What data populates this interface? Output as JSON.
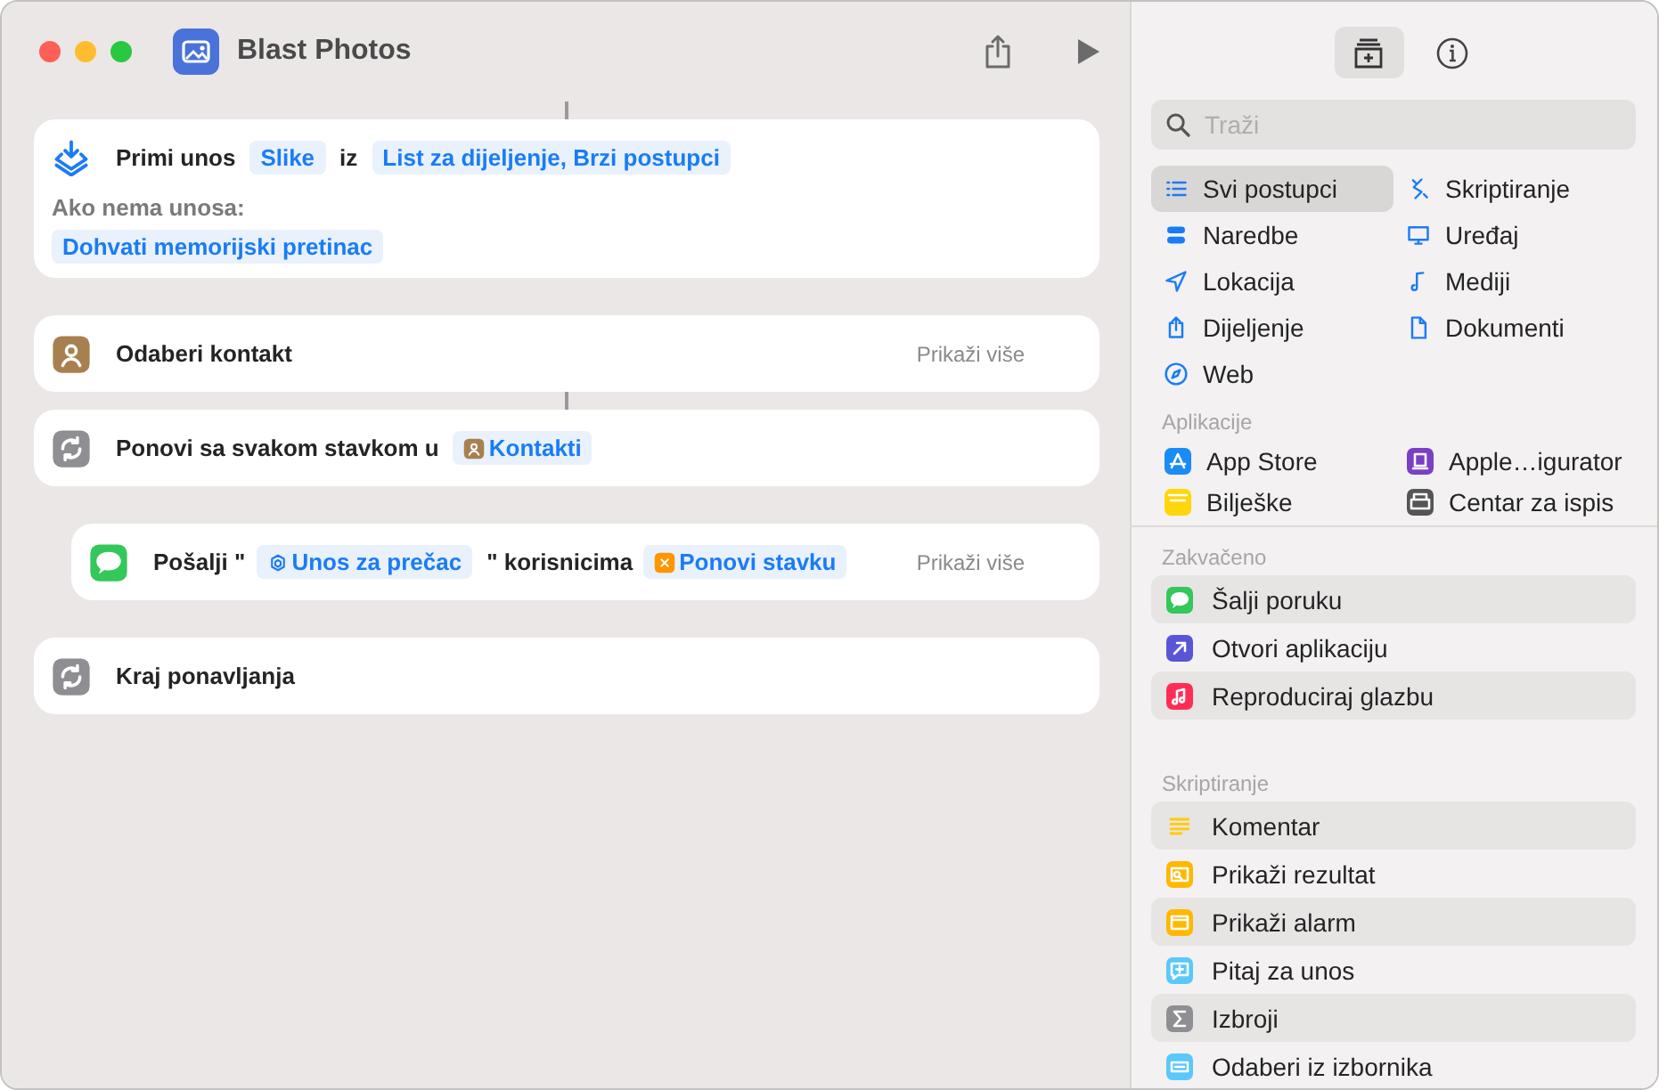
{
  "window": {
    "title": "Blast Photos"
  },
  "workflow": [
    {
      "kind": "receive-input",
      "color": "#1a7cf5",
      "parts": [
        {
          "kind": "text",
          "text": "Primi unos"
        },
        {
          "kind": "token",
          "text": "Slike"
        },
        {
          "kind": "text",
          "text": "iz"
        },
        {
          "kind": "token",
          "text": "List za dijeljenje, Brzi postupci"
        }
      ],
      "fallback_label": "Ako nema unosa:",
      "fallback_token": "Dohvati memorijski pretinac"
    },
    {
      "kind": "choose-contact",
      "color": "#a8804f",
      "parts": [
        {
          "kind": "text",
          "text": "Odaberi kontakt"
        }
      ],
      "show_more": "Prikaži više"
    },
    {
      "kind": "repeat",
      "color": "#8e8e93",
      "parts": [
        {
          "kind": "text",
          "text": "Ponovi sa svakom stavkom u"
        },
        {
          "kind": "contact-token",
          "text": "Kontakti",
          "color": "#a8804f"
        }
      ],
      "children": [
        {
          "kind": "send-message",
          "color": "#34c759",
          "parts": [
            {
              "kind": "text",
              "text": "Pošalji \""
            },
            {
              "kind": "shortcut-token",
              "text": "Unos za prečac",
              "color": "#1a7cf5"
            },
            {
              "kind": "text",
              "text": "\" korisnicima"
            },
            {
              "kind": "variable-token",
              "text": "Ponovi stavku",
              "color": "#ff9500"
            }
          ],
          "show_more": "Prikaži više"
        }
      ]
    },
    {
      "kind": "end-repeat",
      "color": "#8e8e93",
      "parts": [
        {
          "kind": "text",
          "text": "Kraj ponavljanja"
        }
      ]
    }
  ],
  "sidebar": {
    "tabs": [
      {
        "kind": "library",
        "selected": true
      },
      {
        "kind": "info",
        "selected": false
      }
    ],
    "search": {
      "placeholder": "Traži"
    },
    "categories": [
      {
        "label": "Svi postupci",
        "kind": "all",
        "selected": true
      },
      {
        "label": "Skriptiranje",
        "kind": "scripting",
        "selected": false
      },
      {
        "label": "Naredbe",
        "kind": "controls",
        "selected": false
      },
      {
        "label": "Uređaj",
        "kind": "device",
        "selected": false
      },
      {
        "label": "Lokacija",
        "kind": "location",
        "selected": false
      },
      {
        "label": "Mediji",
        "kind": "media",
        "selected": false
      },
      {
        "label": "Dijeljenje",
        "kind": "sharing",
        "selected": false
      },
      {
        "label": "Dokumenti",
        "kind": "documents",
        "selected": false
      },
      {
        "label": "Web",
        "kind": "web",
        "selected": false
      }
    ],
    "apps": {
      "title": "Aplikacije",
      "items": [
        {
          "label": "App Store",
          "kind": "app-store",
          "color": "#1a8cf5"
        },
        {
          "label": "Apple…igurator",
          "kind": "configurator",
          "color": "#7b3fc4"
        },
        {
          "label": "Bilješke",
          "kind": "notes",
          "color": "#ffd60a"
        },
        {
          "label": "Centar za ispis",
          "kind": "printer",
          "color": "#555555"
        }
      ]
    },
    "sections": [
      {
        "title": "Zakvačeno",
        "items": [
          {
            "label": "Šalji poruku",
            "kind": "send-message",
            "color": "#34c759"
          },
          {
            "label": "Otvori aplikaciju",
            "kind": "open-app",
            "color": "#5856d6"
          },
          {
            "label": "Reproduciraj glazbu",
            "kind": "play-music",
            "color": "#ff2d55"
          }
        ]
      },
      {
        "title": "Skriptiranje",
        "items": [
          {
            "label": "Komentar",
            "kind": "comment",
            "color": "#ffcc00"
          },
          {
            "label": "Prikaži rezultat",
            "kind": "show-result",
            "color": "#ffb800"
          },
          {
            "label": "Prikaži alarm",
            "kind": "show-alert",
            "color": "#ffb800"
          },
          {
            "label": "Pitaj za unos",
            "kind": "ask-input",
            "color": "#5ac8fa"
          },
          {
            "label": "Izbroji",
            "kind": "count",
            "color": "#8e8e93"
          },
          {
            "label": "Odaberi iz izbornika",
            "kind": "choose-menu",
            "color": "#5ac8fa"
          }
        ]
      }
    ]
  }
}
